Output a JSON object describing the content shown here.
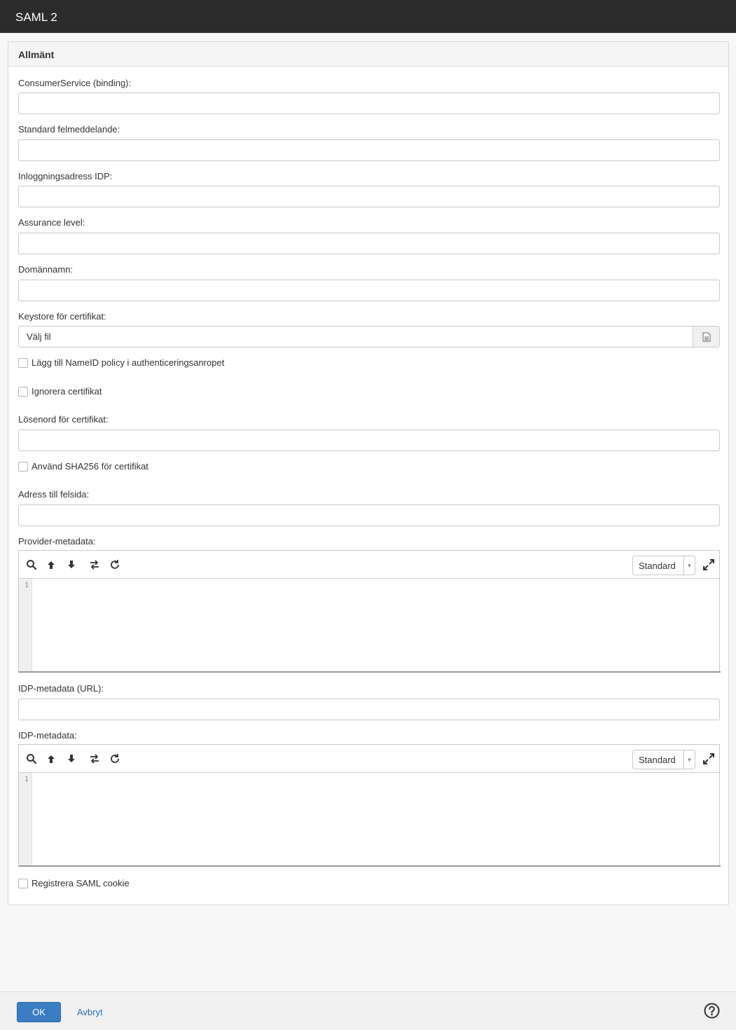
{
  "window": {
    "title": "SAML 2"
  },
  "panel": {
    "title": "Allmänt"
  },
  "fields": {
    "consumer_service": {
      "label": "ConsumerService (binding):",
      "value": ""
    },
    "default_error": {
      "label": "Standard felmeddelande:",
      "value": ""
    },
    "idp_login": {
      "label": "Inloggningsadress IDP:",
      "value": ""
    },
    "assurance": {
      "label": "Assurance level:",
      "value": ""
    },
    "domain": {
      "label": "Domännamn:",
      "value": ""
    },
    "keystore": {
      "label": "Keystore för certifikat:",
      "button_text": "Välj fil"
    },
    "nameid_policy": {
      "label": "Lägg till NameID policy i authenticeringsanropet",
      "checked": false
    },
    "ignore_cert": {
      "label": "Ignorera certifikat",
      "checked": false
    },
    "cert_password": {
      "label": "Lösenord för certifikat:",
      "value": ""
    },
    "sha256": {
      "label": "Använd SHA256 för certifikat",
      "checked": false
    },
    "error_page": {
      "label": "Adress till felsida:",
      "value": ""
    },
    "provider_metadata": {
      "label": "Provider-metadata:",
      "mode": "Standard",
      "line_number": "1"
    },
    "idp_metadata_url": {
      "label": "IDP-metadata (URL):",
      "value": ""
    },
    "idp_metadata": {
      "label": "IDP-metadata:",
      "mode": "Standard",
      "line_number": "1"
    },
    "saml_cookie": {
      "label": "Registrera SAML cookie",
      "checked": false
    }
  },
  "editor_icons": [
    "search-icon",
    "arrow-up-icon",
    "arrow-down-icon",
    "swap-icon",
    "refresh-icon",
    "expand-icon"
  ],
  "footer": {
    "ok_label": "OK",
    "cancel_label": "Avbryt"
  },
  "colors": {
    "titlebar": "#2b2b2b",
    "primary": "#3b7dc1",
    "link": "#2d6fb5"
  }
}
